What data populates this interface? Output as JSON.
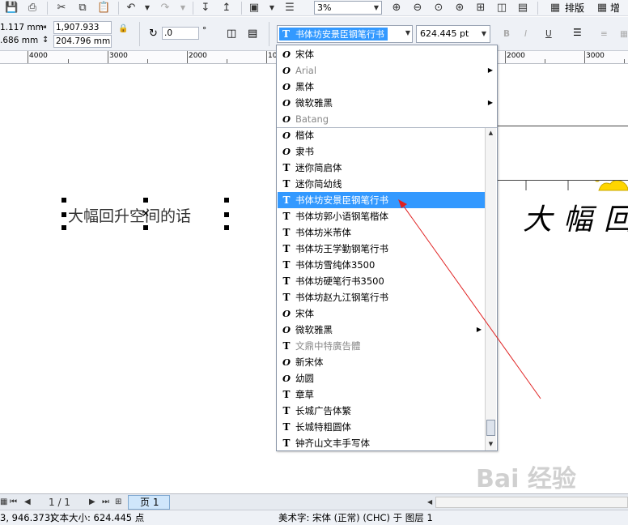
{
  "toolbar": {
    "zoom_value": "3%",
    "layout_label": "排版",
    "increase_label": "增"
  },
  "property_bar": {
    "x_pos": "1.117 mm",
    "y_pos": ".686 mm",
    "width": "1,907.933 mm",
    "height": "204.796 mm",
    "rotation": ".0",
    "rotation_unit": "°",
    "font_name": "书体坊安景臣钢笔行书",
    "font_size": "624.445 pt"
  },
  "ruler": {
    "labels": [
      "4000",
      "3000",
      "2000",
      "10",
      "2000",
      "3000"
    ]
  },
  "canvas": {
    "text_object": "大幅回升空间的话",
    "preview_text": "大幅回"
  },
  "font_list": {
    "recent": [
      {
        "name": "宋体",
        "type": "O",
        "submenu": false,
        "dim": false
      },
      {
        "name": "Arial",
        "type": "O",
        "submenu": true,
        "dim": true
      },
      {
        "name": "黑体",
        "type": "O",
        "submenu": false,
        "dim": false
      },
      {
        "name": "微软雅黑",
        "type": "O",
        "submenu": true,
        "dim": false
      },
      {
        "name": "Batang",
        "type": "O",
        "submenu": false,
        "dim": true
      }
    ],
    "items": [
      {
        "name": "楷体",
        "type": "O",
        "submenu": false,
        "dim": false,
        "selected": false
      },
      {
        "name": "隶书",
        "type": "O",
        "submenu": false,
        "dim": false,
        "selected": false
      },
      {
        "name": "迷你简启体",
        "type": "T",
        "submenu": false,
        "dim": false,
        "selected": false
      },
      {
        "name": "迷你简幼线",
        "type": "T",
        "submenu": false,
        "dim": false,
        "selected": false
      },
      {
        "name": "书体坊安景臣钢笔行书",
        "type": "T",
        "submenu": false,
        "dim": false,
        "selected": true
      },
      {
        "name": "书体坊郭小语钢笔楷体",
        "type": "T",
        "submenu": false,
        "dim": false,
        "selected": false
      },
      {
        "name": "书体坊米芾体",
        "type": "T",
        "submenu": false,
        "dim": false,
        "selected": false
      },
      {
        "name": "书体坊王学勤钢笔行书",
        "type": "T",
        "submenu": false,
        "dim": false,
        "selected": false
      },
      {
        "name": "书体坊雪纯体3500",
        "type": "T",
        "submenu": false,
        "dim": false,
        "selected": false
      },
      {
        "name": "书体坊硬笔行书3500",
        "type": "T",
        "submenu": false,
        "dim": false,
        "selected": false
      },
      {
        "name": "书体坊赵九江钢笔行书",
        "type": "T",
        "submenu": false,
        "dim": false,
        "selected": false
      },
      {
        "name": "宋体",
        "type": "O",
        "submenu": false,
        "dim": false,
        "selected": false
      },
      {
        "name": "微软雅黑",
        "type": "O",
        "submenu": true,
        "dim": false,
        "selected": false
      },
      {
        "name": "文鼎中特廣告體",
        "type": "T",
        "submenu": false,
        "dim": true,
        "selected": false
      },
      {
        "name": "新宋体",
        "type": "O",
        "submenu": false,
        "dim": false,
        "selected": false
      },
      {
        "name": "幼圆",
        "type": "O",
        "submenu": false,
        "dim": false,
        "selected": false
      },
      {
        "name": "章草",
        "type": "T",
        "submenu": false,
        "dim": false,
        "selected": false
      },
      {
        "name": "长城广告体繁",
        "type": "T",
        "submenu": false,
        "dim": false,
        "selected": false
      },
      {
        "name": "长城特粗圆体",
        "type": "T",
        "submenu": false,
        "dim": false,
        "selected": false
      },
      {
        "name": "钟齐山文丰手写体",
        "type": "T",
        "submenu": false,
        "dim": false,
        "selected": false
      }
    ]
  },
  "page_nav": {
    "page_count": "1 / 1",
    "page_tab": "页 1"
  },
  "status": {
    "coords": "3, 946.373)",
    "text_size": "文本大小: 624.445 点",
    "object_info": "美术字: 宋体 (正常) (CHC) 于 图层 1"
  },
  "watermark": "Bai 经验"
}
